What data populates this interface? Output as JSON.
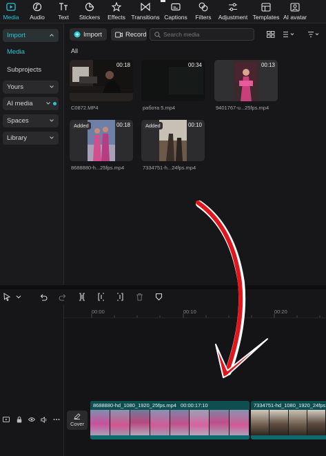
{
  "toolbar": {
    "items": [
      {
        "label": "Media",
        "icon": "media-icon"
      },
      {
        "label": "Audio",
        "icon": "audio-icon"
      },
      {
        "label": "Text",
        "icon": "text-icon"
      },
      {
        "label": "Stickers",
        "icon": "stickers-icon"
      },
      {
        "label": "Effects",
        "icon": "effects-icon"
      },
      {
        "label": "Transitions",
        "icon": "transitions-icon"
      },
      {
        "label": "Captions",
        "icon": "captions-icon"
      },
      {
        "label": "Filters",
        "icon": "filters-icon"
      },
      {
        "label": "Adjustment",
        "icon": "adjustment-icon"
      },
      {
        "label": "Templates",
        "icon": "templates-icon"
      },
      {
        "label": "AI avatar",
        "icon": "ai-avatar-icon"
      }
    ],
    "accent": "#25c6d8"
  },
  "sidebar": {
    "import": "Import",
    "media": "Media",
    "subprojects": "Subprojects",
    "yours": "Yours",
    "ai_media": "AI media",
    "spaces": "Spaces",
    "library": "Library"
  },
  "media": {
    "import_button": "Import",
    "record_button": "Record",
    "search_placeholder": "Search media",
    "filter_label": "All",
    "items": [
      {
        "name": "C0872.MP4",
        "duration": "00:18",
        "added": ""
      },
      {
        "name": "работа 5.mp4",
        "duration": "00:34",
        "added": ""
      },
      {
        "name": "9401767-u...25fps.mp4",
        "duration": "00:13",
        "added": ""
      },
      {
        "name": "8688880-h...25fps.mp4",
        "duration": "00:18",
        "added": "Added"
      },
      {
        "name": "7334751-h...24fps.mp4",
        "duration": "00:10",
        "added": "Added"
      }
    ]
  },
  "timeline": {
    "ticks": [
      "00:00",
      "00:10",
      "00:20"
    ],
    "cover_label": "Cover",
    "clips": [
      {
        "title": "8688880-hd_1080_1920_25fps.mp4",
        "duration": "00:00:17:10"
      },
      {
        "title": "7334751-hd_1080_1920_24fps",
        "duration": ""
      }
    ]
  },
  "annotation": {
    "color": "#e0161c"
  }
}
